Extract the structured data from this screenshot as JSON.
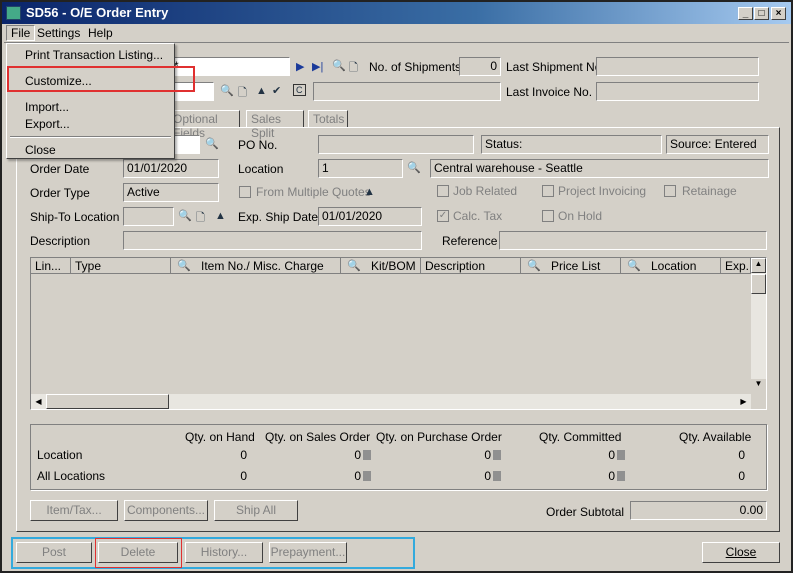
{
  "window": {
    "title": "SD56 - O/E Order Entry",
    "minimize": "_",
    "maximize": "□",
    "close": "×"
  },
  "menubar": {
    "items": [
      "File",
      "Settings",
      "Help"
    ]
  },
  "file_menu": {
    "items": [
      "Print Transaction Listing...",
      "Customize...",
      "Import...",
      "Export...",
      "Close"
    ],
    "highlighted": "Customize..."
  },
  "header": {
    "order_number_suffix": "*",
    "no_of_shipments_label": "No. of Shipments",
    "no_of_shipments": "0",
    "last_shipment_label": "Last Shipment No.",
    "last_shipment": "",
    "last_invoice_label": "Last Invoice No.",
    "last_invoice": ""
  },
  "tabs": [
    "Optional Fields",
    "Sales Split",
    "Totals"
  ],
  "form": {
    "po_label": "PO No.",
    "po": "",
    "status": "Status:",
    "source": "Source: Entered",
    "order_date_label": "Order Date",
    "order_date": "01/01/2020",
    "location_label": "Location",
    "location": "1",
    "location_desc": "Central warehouse - Seattle",
    "order_type_label": "Order Type",
    "order_type": "Active",
    "from_multiple_quotes": "From Multiple Quotes",
    "job_related": "Job Related",
    "project_invoicing": "Project Invoicing",
    "retainage": "Retainage",
    "ship_to_label": "Ship-To Location",
    "ship_to": "",
    "exp_ship_label": "Exp. Ship Date",
    "exp_ship": "01/01/2020",
    "calc_tax": "Calc. Tax",
    "calc_tax_checked": true,
    "on_hold": "On Hold",
    "description_label": "Description",
    "description": "",
    "reference_label": "Reference",
    "reference": ""
  },
  "grid": {
    "columns": [
      "Lin...",
      "Type",
      "Item No./ Misc. Charge",
      "Kit/BOM",
      "Description",
      "Price List",
      "Location",
      "Exp."
    ],
    "rows": []
  },
  "qty": {
    "headers": [
      "Qty. on Hand",
      "Qty. on Sales Order",
      "Qty. on Purchase Order",
      "Qty. Committed",
      "Qty. Available"
    ],
    "rows": [
      {
        "label": "Location",
        "values": [
          "0",
          "0",
          "0",
          "0",
          "0"
        ]
      },
      {
        "label": "All Locations",
        "values": [
          "0",
          "0",
          "0",
          "0",
          "0"
        ]
      }
    ]
  },
  "buttons": {
    "item_tax": "Item/Tax...",
    "components": "Components...",
    "ship_all": "Ship All",
    "order_subtotal_label": "Order Subtotal",
    "order_subtotal": "0.00",
    "post": "Post",
    "delete": "Delete",
    "history": "History...",
    "prepayment": "Prepayment...",
    "close": "Close"
  },
  "colors": {
    "highlight_red": "#e03030",
    "highlight_blue": "#33aadd",
    "title_bar": "#0a246a"
  }
}
